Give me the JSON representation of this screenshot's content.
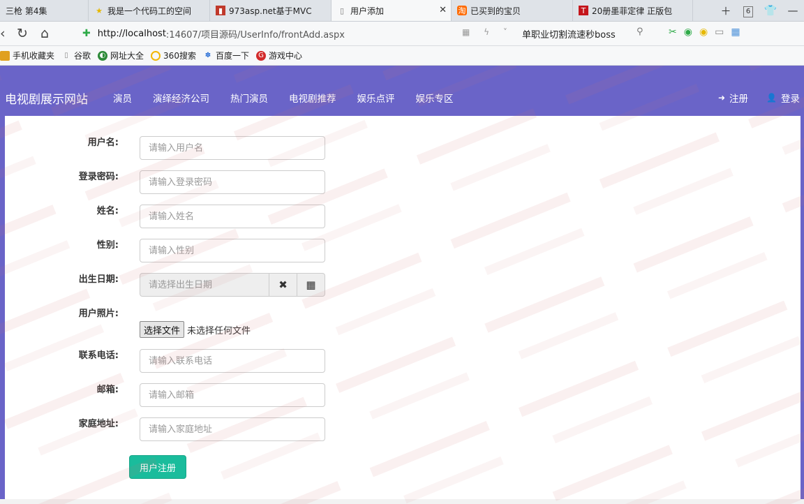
{
  "browser": {
    "tabs": [
      {
        "title": "三枪 第4集",
        "icon": "video-icon",
        "active": false
      },
      {
        "title": "我是一个代码工的空间",
        "icon": "star-icon",
        "active": false
      },
      {
        "title": "973asp.net基于MVC",
        "icon": "red-doc-icon",
        "active": false
      },
      {
        "title": "用户添加",
        "icon": "page-icon",
        "active": true
      },
      {
        "title": "已买到的宝贝",
        "icon": "taobao-icon",
        "active": false
      },
      {
        "title": "20册墨菲定律 正版包",
        "icon": "tmall-icon",
        "active": false
      }
    ],
    "tab_count": "6",
    "url_host": "http://localhost",
    "url_rest": ":14607/项目源码/UserInfo/frontAdd.aspx",
    "search_text": "单职业切割流速秒boss",
    "bookmarks": [
      {
        "label": "手机收藏夹",
        "icon": "folder-icon",
        "color": "#e0a020"
      },
      {
        "label": "谷歌",
        "icon": "doc-icon",
        "color": "#888888"
      },
      {
        "label": "网址大全",
        "icon": "globe-icon",
        "color": "#2e8b3a"
      },
      {
        "label": "360搜索",
        "icon": "search360-icon",
        "color": "#f2b705"
      },
      {
        "label": "百度一下",
        "icon": "baidu-paw-icon",
        "color": "#2a6fd6"
      },
      {
        "label": "游戏中心",
        "icon": "game-icon",
        "color": "#d22b2b"
      }
    ]
  },
  "site": {
    "brand": "电视剧展示网站",
    "menu": [
      "演员",
      "演绎经济公司",
      "热门演员",
      "电视剧推荐",
      "娱乐点评",
      "娱乐专区"
    ],
    "register": "注册",
    "login": "登录"
  },
  "form": {
    "username": {
      "label": "用户名:",
      "placeholder": "请输入用户名"
    },
    "password": {
      "label": "登录密码:",
      "placeholder": "请输入登录密码"
    },
    "name": {
      "label": "姓名:",
      "placeholder": "请输入姓名"
    },
    "gender": {
      "label": "性别:",
      "placeholder": "请输入性别"
    },
    "birthday": {
      "label": "出生日期:",
      "placeholder": "请选择出生日期"
    },
    "photo": {
      "label": "用户照片:",
      "button": "选择文件",
      "status": "未选择任何文件"
    },
    "phone": {
      "label": "联系电话:",
      "placeholder": "请输入联系电话"
    },
    "email": {
      "label": "邮箱:",
      "placeholder": "请输入邮箱"
    },
    "address": {
      "label": "家庭地址:",
      "placeholder": "请输入家庭地址"
    },
    "submit": "用户注册"
  },
  "colors": {
    "navbar": "#6a64c8",
    "submit": "#1abc9c"
  }
}
